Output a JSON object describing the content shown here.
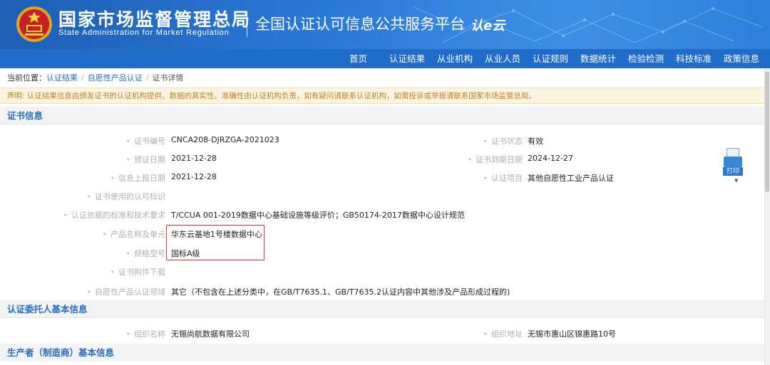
{
  "header": {
    "brand_cn": "国家市场监督管理总局",
    "brand_en": "State Administration  for  Market Regulation",
    "platform": "全国认证认可信息公共服务平台",
    "platform_logo": "认e云",
    "colors": {
      "banner": "#2a78d6",
      "nav": "#1f6cc9"
    }
  },
  "nav": {
    "items": [
      "首页",
      "认证结果",
      "从业机构",
      "从业人员",
      "认证规则",
      "数据统计",
      "检验检测",
      "科技标准",
      "政策信息"
    ]
  },
  "breadcrumb": {
    "prefix": "当前位置：",
    "items": [
      "认证结果",
      "自愿性产品认证",
      "证书详情"
    ]
  },
  "notice": "声明: 认证结果信息由颁发证书的认证机构提供，数据的真实性、准确性由认证机构负责，如有疑问请联系认证机构，如需投诉或举报请联系国家市场监管总局。",
  "cert_section": {
    "title": "证书信息",
    "fields": {
      "cert_no_label": "证书编号",
      "cert_no": "CNCA208-DJRZGA-2021023",
      "cert_status_label": "证书状态",
      "cert_status": "有效",
      "issue_date_label": "颁证日期",
      "issue_date": "2021-12-28",
      "expire_date_label": "证书到期日期",
      "expire_date": "2024-12-27",
      "report_date_label": "信息上报日期",
      "report_date": "2021-12-28",
      "project_label": "认证项目",
      "project": "其他自愿性工业产品认证",
      "mark_label": "证书使用的认可标识",
      "standard_label": "认证依据的标准和技术要求",
      "standard": "T/CCUA 001-2019数据中心基础设施等级评价；GB50174-2017数据中心设计规范",
      "product_label": "产品名称及单元",
      "product": "华东云基地1号楼数据中心",
      "model_label": "规格型号",
      "model": "国标A级",
      "attach_label": "证书附件下载",
      "domain_label": "自愿性产品认证领域",
      "domain": "其它（不包含在上述分类中，在GB/T7635.1、GB/T7635.2认证内容中其他涉及产品形成过程的)"
    }
  },
  "client_section": {
    "title": "认证委托人基本信息",
    "org_name_label": "组织名称",
    "org_name": "无锡尚航数据有限公司",
    "org_addr_label": "组织地址",
    "org_addr": "无锡市惠山区锦惠路10号"
  },
  "maker_section": {
    "title": "生产者（制造商）基本信息"
  },
  "print": {
    "label": "打印"
  },
  "highlight_color": "#e1312c"
}
